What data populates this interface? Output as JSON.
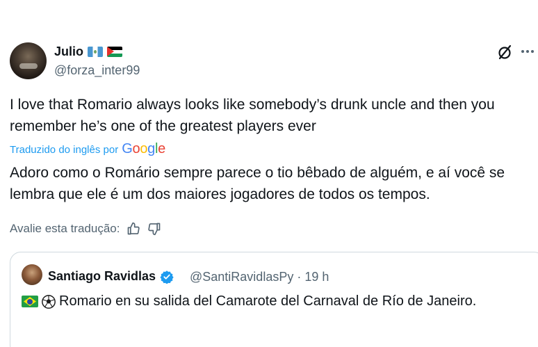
{
  "tweet": {
    "author": {
      "name": "Julio",
      "handle": "@forza_inter99",
      "flags": [
        "guatemala-flag",
        "palestine-flag"
      ]
    },
    "original_text": "I love that Romario always looks like somebody’s drunk uncle and then you remember he’s one of the greatest players ever",
    "translated_by_label": "Traduzido do inglês por",
    "translation_provider": "Google",
    "translated_text": "Adoro como o Romário sempre parece o tio bêbado de alguém, e aí você se lembra que ele é um dos maiores jogadores de todos os tempos.",
    "rate_label": "Avalie esta tradução:",
    "icons": [
      "grok-icon",
      "more-icon",
      "thumbs-up-icon",
      "thumbs-down-icon"
    ]
  },
  "quoted_tweet": {
    "author_name": "Santiago Ravidlas",
    "meta": "@SantiRavidlasPy · 19 h",
    "text": "Romario en su salida del Camarote del Carnaval de Río de Janeiro.",
    "icons": [
      "verified-icon",
      "brazil-flag",
      "soccer-ball-icon"
    ]
  },
  "colors": {
    "text": "#0f1419",
    "secondary": "#536471",
    "link": "#1d9bf0",
    "border": "#cfd9de"
  }
}
